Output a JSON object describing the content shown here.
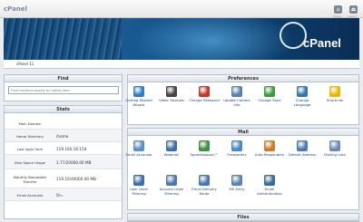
{
  "topbar": {
    "brand": "cPanel",
    "home_label": "Home",
    "logout_label": "Logout"
  },
  "banner": {
    "logo": "cPanel"
  },
  "breadcrumb": {
    "text": "cPanel 11"
  },
  "find": {
    "title": "Find",
    "placeholder": "Find functions quickly by typing here."
  },
  "stats": {
    "title": "Stats",
    "rows": [
      {
        "key": "Main Domain",
        "value": ""
      },
      {
        "key": "Home Directory",
        "value": "/home"
      },
      {
        "key": "Last login from",
        "value": "119.160.18.154"
      },
      {
        "key": "Disk Space Usage",
        "value": "1.77/20000.00 MB"
      },
      {
        "key": "Monthly Bandwidth Transfer",
        "value": "119.10/40000.00 MB"
      },
      {
        "key": "Email Accounts",
        "value": "0/∞"
      }
    ]
  },
  "preferences": {
    "title": "Preferences",
    "items": [
      {
        "label": "Getting Started Wizard",
        "icon": "wizard-icon",
        "color": "#2f7dc4"
      },
      {
        "label": "Video Tutorials",
        "icon": "film-icon",
        "color": "#444444"
      },
      {
        "label": "Change Password",
        "icon": "password-icon",
        "color": "#c0392b"
      },
      {
        "label": "Update Contact Info",
        "icon": "contact-icon",
        "color": "#5a7fa8"
      },
      {
        "label": "Change Style",
        "icon": "style-icon",
        "color": "#3f9a3f"
      },
      {
        "label": "Change Language",
        "icon": "language-icon",
        "color": "#3575b5"
      },
      {
        "label": "Shortcuts",
        "icon": "star-icon",
        "color": "#e6b800"
      }
    ]
  },
  "mail": {
    "title": "Mail",
    "items": [
      {
        "label": "Email Accounts",
        "icon": "email-icon",
        "color": "#5b8ec2"
      },
      {
        "label": "Webmail",
        "icon": "webmail-icon",
        "color": "#3d6ea8"
      },
      {
        "label": "SpamAssassin™",
        "icon": "spam-icon",
        "color": "#3f8f3f"
      },
      {
        "label": "Forwarders",
        "icon": "forwarders-icon",
        "color": "#4a86c5"
      },
      {
        "label": "Auto Responders",
        "icon": "autoresponder-icon",
        "color": "#c77d2a"
      },
      {
        "label": "Default Address",
        "icon": "default-address-icon",
        "color": "#4a7bb0"
      },
      {
        "label": "Mailing Lists",
        "icon": "mailing-list-icon",
        "color": "#6a8bb5"
      },
      {
        "label": "User Level Filtering",
        "icon": "user-filter-icon",
        "color": "#3c6fa8"
      },
      {
        "label": "Account Level Filtering",
        "icon": "account-filter-icon",
        "color": "#4b7aa9"
      },
      {
        "label": "Email Delivery Route",
        "icon": "delivery-route-icon",
        "color": "#4478b2"
      },
      {
        "label": "MX Entry",
        "icon": "mx-entry-icon",
        "color": "#5b83ad"
      },
      {
        "label": "Email Authentication",
        "icon": "authentication-icon",
        "color": "#3a6a9e"
      }
    ]
  },
  "files": {
    "title": "Files"
  }
}
